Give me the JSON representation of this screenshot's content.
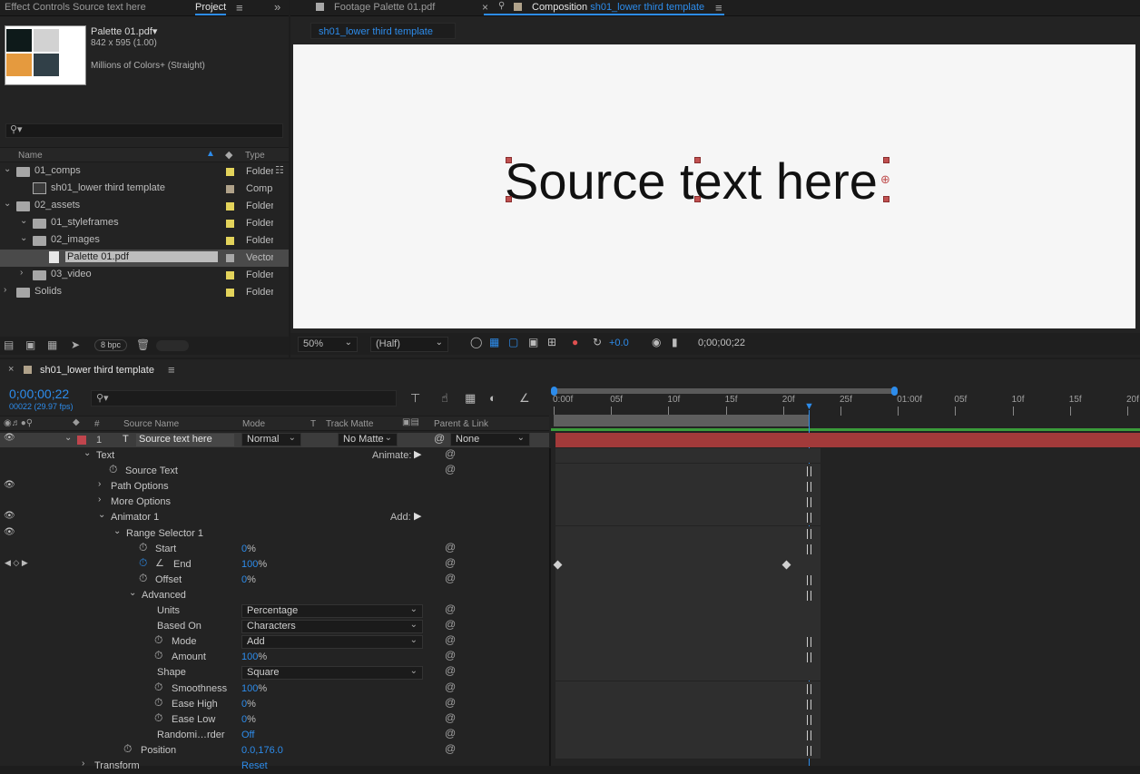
{
  "project_panel": {
    "tab_effect_controls": "Effect Controls Source text here",
    "tab_project": "Project",
    "item_name": "Palette 01.pdf▾",
    "item_dims": "842 x 595 (1.00)",
    "item_colors": "Millions of Colors+ (Straight)",
    "swatches": [
      "#0e1a1a",
      "#d2d2d2",
      "#e59a3e",
      "#314048"
    ],
    "columns": {
      "name": "Name",
      "type": "Type"
    },
    "rows": [
      {
        "name": "01_comps",
        "type": "Folder",
        "color": "#e3d35b"
      },
      {
        "name": "sh01_lower third template",
        "type": "Comp",
        "color": "#b0a28a"
      },
      {
        "name": "02_assets",
        "type": "Folder",
        "color": "#e3d35b"
      },
      {
        "name": "01_styleframes",
        "type": "Folder",
        "color": "#e3d35b"
      },
      {
        "name": "02_images",
        "type": "Folder",
        "color": "#e3d35b"
      },
      {
        "name": "Palette 01.pdf",
        "type": "Vector",
        "color": "#a8a8a8"
      },
      {
        "name": "03_video",
        "type": "Folder",
        "color": "#e3d35b"
      },
      {
        "name": "Solids",
        "type": "Folder",
        "color": "#e3d35b"
      }
    ],
    "bpc": "8 bpc"
  },
  "viewer": {
    "tab_footage": "Footage Palette 01.pdf",
    "tab_comp_prefix": "Composition",
    "tab_comp_name": "sh01_lower third template",
    "breadcrumb": "sh01_lower third template",
    "canvas_text": "Source text here",
    "zoom": "50%",
    "resolution": "(Half)",
    "exposure": "+0.0",
    "timecode": "0;00;00;22"
  },
  "timeline": {
    "comp_tab": "sh01_lower third template",
    "timecode": "0;00;00;22",
    "frame_info": "00022 (29.97 fps)",
    "columns": {
      "num": "#",
      "source": "Source Name",
      "mode": "Mode",
      "t": "T",
      "matte": "Track Matte",
      "parent": "Parent & Link"
    },
    "layer": {
      "num": "1",
      "name": "Source text here",
      "mode": "Normal",
      "matte": "No Matte",
      "parent": "None"
    },
    "ruler": [
      "0:00f",
      "05f",
      "10f",
      "15f",
      "20f",
      "25f",
      "01:00f",
      "05f",
      "10f",
      "15f",
      "20f"
    ],
    "props": {
      "text": "Text",
      "animate": "Animate:",
      "source_text": "Source Text",
      "path_options": "Path Options",
      "more_options": "More Options",
      "animator": "Animator 1",
      "add": "Add:",
      "range_selector": "Range Selector 1",
      "start": "Start",
      "start_val": "0",
      "end": "End",
      "end_val": "100",
      "offset": "Offset",
      "offset_val": "0",
      "advanced": "Advanced",
      "units": "Units",
      "units_val": "Percentage",
      "based_on": "Based On",
      "based_on_val": "Characters",
      "mode": "Mode",
      "mode_val": "Add",
      "amount": "Amount",
      "amount_val": "100",
      "shape": "Shape",
      "shape_val": "Square",
      "smoothness": "Smoothness",
      "smoothness_val": "100",
      "ease_high": "Ease High",
      "ease_high_val": "0",
      "ease_low": "Ease Low",
      "ease_low_val": "0",
      "randomize": "Randomi…rder",
      "randomize_val": "Off",
      "position": "Position",
      "position_val": "0.0,176.0",
      "transform": "Transform",
      "reset": "Reset",
      "pct": "%"
    }
  }
}
